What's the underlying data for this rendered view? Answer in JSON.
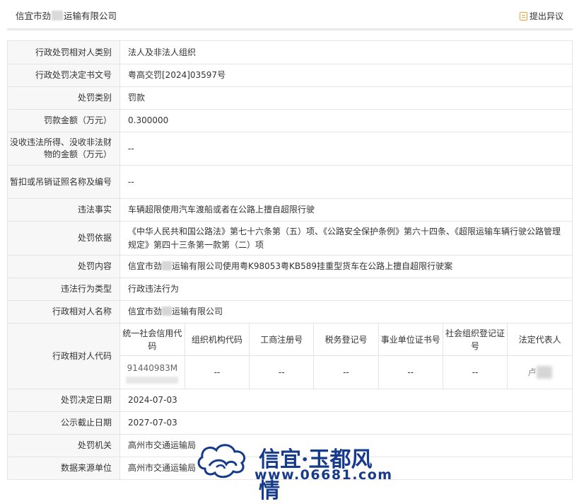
{
  "header": {
    "title_prefix": "信宜市劲",
    "title_suffix": "运输有限公司",
    "objection_label": "提出异议"
  },
  "rows": {
    "party_type": {
      "label": "行政处罚相对人类别",
      "value": "法人及非法人组织"
    },
    "decision_no": {
      "label": "行政处罚决定书文号",
      "value": "粤高交罚[2024]03597号"
    },
    "penalty_type": {
      "label": "处罚类别",
      "value": "罚款"
    },
    "fine_amount": {
      "label": "罚款金额（万元）",
      "value": "0.300000"
    },
    "confiscation": {
      "label": "没收违法所得、没收非法财物的金额（万元）",
      "value": "--"
    },
    "license": {
      "label": "暂扣或吊销证照名称及编号",
      "value": "--"
    },
    "violation_fact": {
      "label": "违法事实",
      "value": "车辆超限使用汽车渡船或者在公路上擅自超限行驶"
    },
    "basis": {
      "label": "处罚依据",
      "value": "《中华人民共和国公路法》第七十六条第（五）项、《公路安全保护条例》第六十四条、《超限运输车辆行驶公路管理规定》第四十三条第一款第（二）项"
    },
    "content": {
      "label": "处罚内容",
      "value_prefix": "信宜市劲",
      "value_suffix": "运输有限公司使用粤K98053粤KB589挂重型货车在公路上擅自超限行驶案"
    },
    "behavior_type": {
      "label": "违法行为类型",
      "value": "行政违法行为"
    },
    "party_name": {
      "label": "行政相对人名称",
      "value_prefix": "信宜市劲",
      "value_suffix": "运输有限公司"
    },
    "party_code": {
      "label": "行政相对人代码",
      "headers": [
        "统一社会信用代码",
        "组织机构代码",
        "工商注册号",
        "税务登记号",
        "事业单位证书号",
        "社会组织登记证号",
        "法定代表人"
      ],
      "values": [
        "91440983M",
        "--",
        "--",
        "--",
        "--",
        "--",
        "卢"
      ]
    },
    "decision_date": {
      "label": "处罚决定日期",
      "value": "2024-07-03"
    },
    "publicity_deadline": {
      "label": "公示截止日期",
      "value": "2027-07-03"
    },
    "authority": {
      "label": "处罚机关",
      "value": "高州市交通运输局"
    },
    "data_source": {
      "label": "数据来源单位",
      "value": "高州市交通运输局"
    }
  },
  "watermark": {
    "title": "信宜·玉都风情",
    "url": "www.06681.com"
  }
}
